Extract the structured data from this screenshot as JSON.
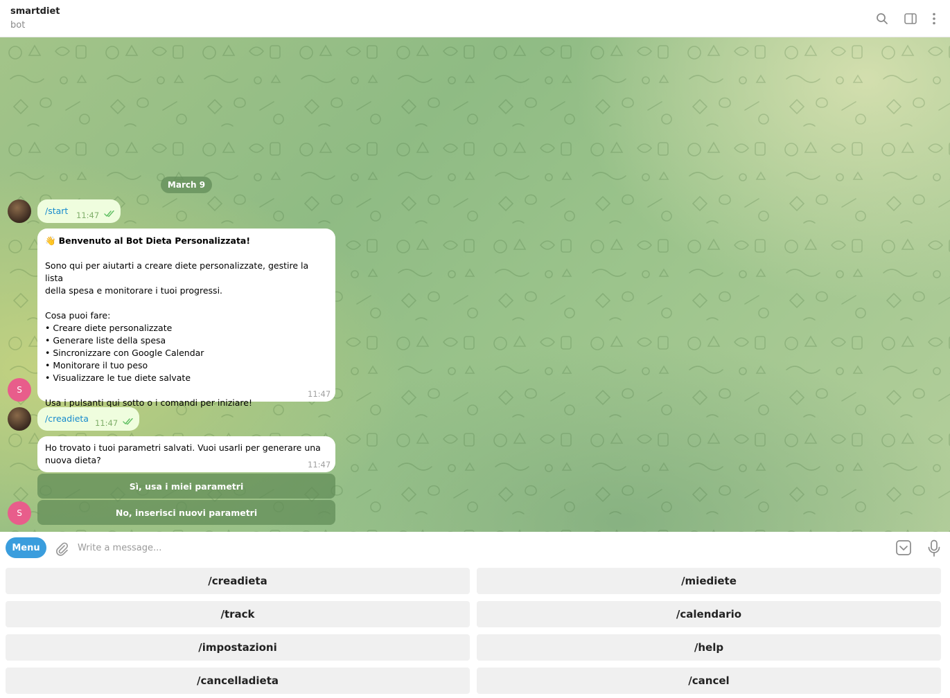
{
  "header": {
    "title": "smartdiet",
    "subtitle": "bot"
  },
  "chat": {
    "date": "March 9",
    "messages": [
      {
        "type": "outgoing",
        "text": "/start",
        "time": "11:47"
      },
      {
        "type": "incoming",
        "title": "Benvenuto al Bot Dieta Personalizzata!",
        "emoji": "👋",
        "lines": [
          "",
          "Sono qui per aiutarti a creare diete personalizzate, gestire la lista",
          "della spesa e monitorare i tuoi progressi.",
          "",
          "Cosa puoi fare:",
          "• Creare diete personalizzate",
          "• Generare liste della spesa",
          "• Sincronizzare con Google Calendar",
          "• Monitorare il tuo peso",
          "• Visualizzare le tue diete salvate",
          "",
          "Usa i pulsanti qui sotto o i comandi per iniziare!"
        ],
        "time": "11:47"
      },
      {
        "type": "outgoing",
        "text": "/creadieta",
        "time": "11:47"
      },
      {
        "type": "incoming",
        "lines": [
          "Ho trovato i tuoi parametri salvati. Vuoi usarli per generare una",
          "nuova dieta?"
        ],
        "time": "11:47"
      }
    ],
    "inline_buttons": [
      "Sì, usa i miei parametri",
      "No, inserisci nuovi parametri"
    ],
    "bot_avatar_letter": "S"
  },
  "input": {
    "menu_label": "Menu",
    "placeholder": "Write a message..."
  },
  "keyboard": {
    "buttons": [
      "/creadieta",
      "/miediete",
      "/track",
      "/calendario",
      "/impostazioni",
      "/help",
      "/cancelladieta",
      "/cancel"
    ]
  },
  "colors": {
    "menu_button": "#3a9ddd",
    "outgoing_bubble": "#effdde",
    "link": "#168acd",
    "bot_avatar": "#e85d8b"
  },
  "icons": [
    "search-icon",
    "sidebar-toggle-icon",
    "more-vertical-icon",
    "attach-icon",
    "bot-keyboard-icon",
    "microphone-icon",
    "double-check-icon"
  ]
}
